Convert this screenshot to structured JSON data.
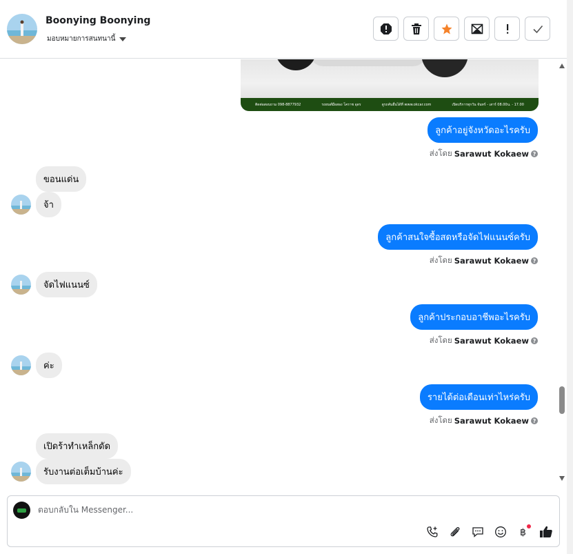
{
  "header": {
    "contact_name": "Boonying Boonying",
    "assign_label": "มอบหมายการสนทนานี้",
    "actions": [
      "spam-icon",
      "trash-icon",
      "star-icon",
      "mark-unread-icon",
      "important-icon",
      "done-icon"
    ],
    "star_color": "#f5822a"
  },
  "attachment_footer": [
    "ติดต่อสอบถาม 098-8877932",
    "รถยนต์มือสอง โคราช อุดร",
    "ดูรถคันอื่นได้ที่ www.okcar.com",
    "เปิดบริการทุกวัน จันทร์ - เสาร์ 08.00น. - 17.00"
  ],
  "messages": [
    {
      "dir": "out",
      "text": "ลูกค้าอยู่จังหวัดอะไรครับ",
      "sent_by_prefix": "ส่งโดย",
      "agent": "Sarawut Kokaew"
    },
    {
      "dir": "in",
      "text": "ขอนแด่น"
    },
    {
      "dir": "in",
      "text": "จ้า"
    },
    {
      "dir": "out",
      "text": "ลูกค้าสนใจซื้อสดหรือจัดไฟแนนซ์ครับ",
      "sent_by_prefix": "ส่งโดย",
      "agent": "Sarawut Kokaew"
    },
    {
      "dir": "in",
      "text": "จัดไฟแนนซ์"
    },
    {
      "dir": "out",
      "text": "ลูกค้าประกอบอาชีพอะไรครับ",
      "sent_by_prefix": "ส่งโดย",
      "agent": "Sarawut Kokaew"
    },
    {
      "dir": "in",
      "text": "ค่ะ"
    },
    {
      "dir": "out",
      "text": "รายได้ต่อเดือนเท่าไหร่ครับ",
      "sent_by_prefix": "ส่งโดย",
      "agent": "Sarawut Kokaew"
    },
    {
      "dir": "in",
      "text": "เปิดร้าทำเหล็กดัด"
    },
    {
      "dir": "in",
      "text": "รับงานต่อเต็มบ้านค่ะ"
    }
  ],
  "composer": {
    "placeholder": "ตอบกลับใน Messenger...",
    "tools": [
      "phone-add-icon",
      "attach-icon",
      "saved-reply-icon",
      "emoji-icon",
      "baht-payment-icon",
      "like-icon"
    ]
  },
  "colors": {
    "outgoing_bubble": "#0a7cff",
    "incoming_bubble": "#ececec",
    "help_icon": "#8a8d91"
  }
}
